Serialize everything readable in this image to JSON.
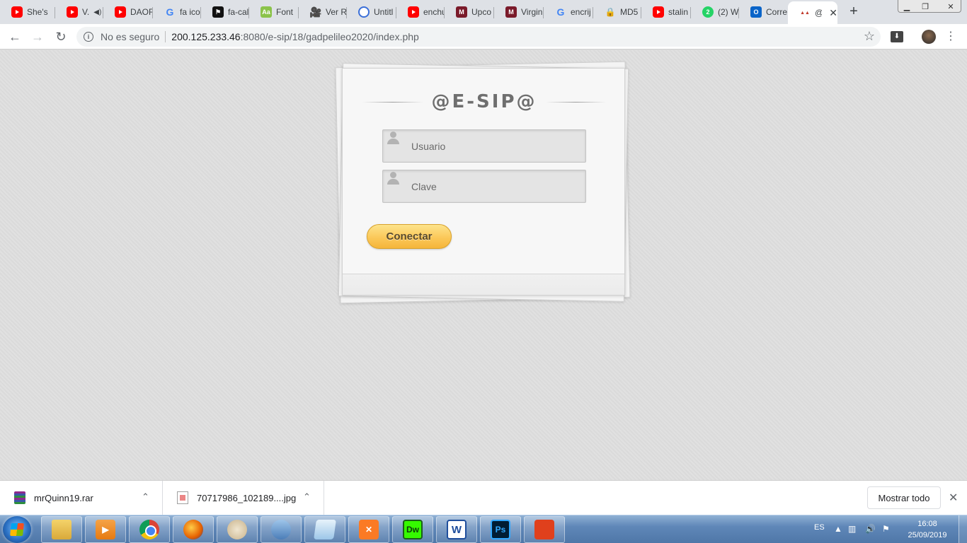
{
  "browser": {
    "tabs": [
      {
        "title": "She's",
        "icon": "youtube-icon"
      },
      {
        "title": "V.",
        "icon": "youtube-icon",
        "audio": "speaker-icon"
      },
      {
        "title": "DAOR",
        "icon": "youtube-icon"
      },
      {
        "title": "fa ico",
        "icon": "google-icon"
      },
      {
        "title": "fa-cal",
        "icon": "flag-icon"
      },
      {
        "title": "Font",
        "icon": "font-icon"
      },
      {
        "title": "Ver R",
        "icon": "film-icon"
      },
      {
        "title": "Untitl",
        "icon": "globe-icon"
      },
      {
        "title": "enchu",
        "icon": "youtube-icon"
      },
      {
        "title": "Upco",
        "icon": "ff-icon"
      },
      {
        "title": "Virgin",
        "icon": "ff-icon"
      },
      {
        "title": "encrij",
        "icon": "google-icon"
      },
      {
        "title": "MD5",
        "icon": "lock-icon"
      },
      {
        "title": "stalin",
        "icon": "youtube-icon"
      },
      {
        "title": "(2) W",
        "icon": "whatsapp-icon"
      },
      {
        "title": "Corre",
        "icon": "outlook-icon"
      },
      {
        "title": "@",
        "icon": "esip-icon",
        "active": true,
        "close": "✕"
      }
    ],
    "window_controls": {
      "minimize": "▁",
      "maximize": "❐",
      "close": "✕"
    },
    "newtab": "+",
    "toolbar": {
      "back": "←",
      "forward": "→",
      "reload": "↻",
      "security_label": "No es seguro",
      "url_host": "200.125.233.46",
      "url_rest": ":8080/e-sip/18/gadpelileo2020/index.php",
      "star": "☆",
      "extension": "⬇",
      "menu": "⋮"
    }
  },
  "page": {
    "heading": "@E-SIP@",
    "username_placeholder": "Usuario",
    "password_placeholder": "Clave",
    "submit_label": "Conectar"
  },
  "download_shelf": {
    "items": [
      {
        "name": "mrQuinn19.rar",
        "chevron": "⌃"
      },
      {
        "name": "70717986_102189....jpg",
        "chevron": "⌃"
      }
    ],
    "show_all": "Mostrar todo",
    "close": "✕"
  },
  "taskbar": {
    "apps": [
      "explorer-icon",
      "media-player-icon",
      "chrome-icon",
      "firefox-icon",
      "paint-icon",
      "dolphin-icon",
      "notepad-icon",
      "xampp-icon",
      "dreamweaver-icon",
      "word-icon",
      "photoshop-icon",
      "acrobat-icon"
    ],
    "app_letters": {
      "dreamweaver": "Dw",
      "word": "W",
      "photoshop": "Ps",
      "xampp": "✕"
    },
    "language": "ES",
    "time": "16:08",
    "date": "25/09/2019"
  }
}
